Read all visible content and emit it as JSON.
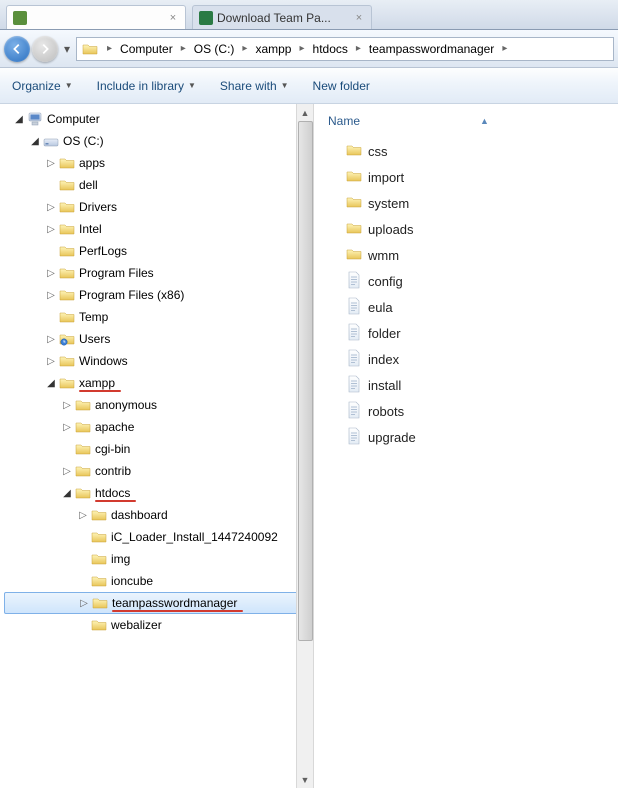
{
  "tabs": [
    {
      "label": "",
      "active": true
    },
    {
      "label": "Download Team Pa...",
      "active": false
    }
  ],
  "path": [
    "Computer",
    "OS (C:)",
    "xampp",
    "htdocs",
    "teampasswordmanager"
  ],
  "toolbar": {
    "organize": "Organize",
    "include": "Include in library",
    "share": "Share with",
    "newfolder": "New folder"
  },
  "column": {
    "name": "Name"
  },
  "tree": [
    {
      "depth": 0,
      "arrow": "open",
      "icon": "computer",
      "label": "Computer"
    },
    {
      "depth": 1,
      "arrow": "open",
      "icon": "drive",
      "label": "OS (C:)"
    },
    {
      "depth": 2,
      "arrow": "closed",
      "icon": "folder",
      "label": "apps"
    },
    {
      "depth": 2,
      "arrow": "none",
      "icon": "folder",
      "label": "dell"
    },
    {
      "depth": 2,
      "arrow": "closed",
      "icon": "folder",
      "label": "Drivers"
    },
    {
      "depth": 2,
      "arrow": "closed",
      "icon": "folder",
      "label": "Intel"
    },
    {
      "depth": 2,
      "arrow": "none",
      "icon": "folder",
      "label": "PerfLogs"
    },
    {
      "depth": 2,
      "arrow": "closed",
      "icon": "folder",
      "label": "Program Files"
    },
    {
      "depth": 2,
      "arrow": "closed",
      "icon": "folder",
      "label": "Program Files (x86)"
    },
    {
      "depth": 2,
      "arrow": "none",
      "icon": "folder",
      "label": "Temp"
    },
    {
      "depth": 2,
      "arrow": "closed",
      "icon": "folder-clock",
      "label": "Users"
    },
    {
      "depth": 2,
      "arrow": "closed",
      "icon": "folder",
      "label": "Windows"
    },
    {
      "depth": 2,
      "arrow": "open",
      "icon": "folder",
      "label": "xampp",
      "underline": true
    },
    {
      "depth": 3,
      "arrow": "closed",
      "icon": "folder",
      "label": "anonymous"
    },
    {
      "depth": 3,
      "arrow": "closed",
      "icon": "folder",
      "label": "apache"
    },
    {
      "depth": 3,
      "arrow": "none",
      "icon": "folder",
      "label": "cgi-bin"
    },
    {
      "depth": 3,
      "arrow": "closed",
      "icon": "folder",
      "label": "contrib"
    },
    {
      "depth": 3,
      "arrow": "open",
      "icon": "folder",
      "label": "htdocs",
      "underline": true
    },
    {
      "depth": 4,
      "arrow": "closed",
      "icon": "folder",
      "label": "dashboard"
    },
    {
      "depth": 4,
      "arrow": "none",
      "icon": "folder",
      "label": "iC_Loader_Install_1447240092"
    },
    {
      "depth": 4,
      "arrow": "none",
      "icon": "folder",
      "label": "img"
    },
    {
      "depth": 4,
      "arrow": "none",
      "icon": "folder",
      "label": "ioncube"
    },
    {
      "depth": 4,
      "arrow": "closed",
      "icon": "folder",
      "label": "teampasswordmanager",
      "underline": true,
      "selected": true
    },
    {
      "depth": 4,
      "arrow": "none",
      "icon": "folder",
      "label": "webalizer"
    }
  ],
  "items": [
    {
      "type": "folder",
      "label": "css"
    },
    {
      "type": "folder",
      "label": "import"
    },
    {
      "type": "folder",
      "label": "system"
    },
    {
      "type": "folder",
      "label": "uploads"
    },
    {
      "type": "folder",
      "label": "wmm"
    },
    {
      "type": "file",
      "label": "config"
    },
    {
      "type": "file",
      "label": "eula"
    },
    {
      "type": "file",
      "label": "folder"
    },
    {
      "type": "file",
      "label": "index"
    },
    {
      "type": "file",
      "label": "install"
    },
    {
      "type": "file",
      "label": "robots"
    },
    {
      "type": "file",
      "label": "upgrade"
    }
  ]
}
